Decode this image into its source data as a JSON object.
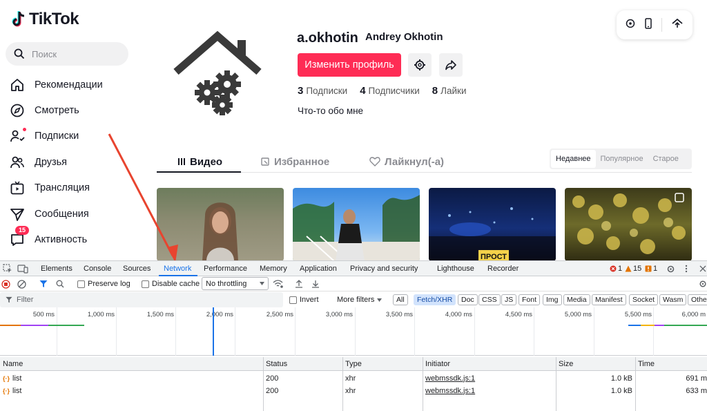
{
  "brand": {
    "name": "TikTok"
  },
  "search": {
    "placeholder": "Поиск"
  },
  "nav": [
    {
      "label": "Рекомендации",
      "icon": "home-icon"
    },
    {
      "label": "Смотреть",
      "icon": "compass-icon"
    },
    {
      "label": "Подписки",
      "icon": "following-icon"
    },
    {
      "label": "Друзья",
      "icon": "friends-icon"
    },
    {
      "label": "Трансляция",
      "icon": "live-icon"
    },
    {
      "label": "Сообщения",
      "icon": "messages-icon"
    },
    {
      "label": "Активность",
      "icon": "activity-icon",
      "badge": "15"
    }
  ],
  "profile": {
    "username": "a.okhotin",
    "nickname": "Andrey Okhotin",
    "edit_button": "Изменить профиль",
    "stats": [
      {
        "value": "3",
        "label": "Подписки"
      },
      {
        "value": "4",
        "label": "Подписчики"
      },
      {
        "value": "8",
        "label": "Лайки"
      }
    ],
    "bio": "Что-то обо мне"
  },
  "content_tabs": [
    "Видео",
    "Избранное",
    "Лайкнул(-а)"
  ],
  "sort_options": [
    "Недавнее",
    "Популярное",
    "Старое"
  ],
  "thumbnail_overlay": "ПРОСТ",
  "devtools": {
    "tabs": [
      "Elements",
      "Console",
      "Sources",
      "Network",
      "Performance",
      "Memory",
      "Application",
      "Privacy and security",
      "Lighthouse",
      "Recorder"
    ],
    "active_tab": "Network",
    "status": {
      "errors": "1",
      "warnings": "15",
      "issues": "1"
    },
    "toolbar": {
      "preserve_log": "Preserve log",
      "disable_cache": "Disable cache",
      "throttling": "No throttling"
    },
    "filter": {
      "placeholder": "Filter",
      "invert": "Invert",
      "more_filters": "More filters",
      "types": [
        "All",
        "Fetch/XHR",
        "Doc",
        "CSS",
        "JS",
        "Font",
        "Img",
        "Media",
        "Manifest",
        "Socket",
        "Wasm",
        "Other"
      ],
      "active_type": "Fetch/XHR"
    },
    "timeline_ticks": [
      "500 ms",
      "1,000 ms",
      "1,500 ms",
      "2,000 ms",
      "2,500 ms",
      "3,000 ms",
      "3,500 ms",
      "4,000 ms",
      "4,500 ms",
      "5,000 ms",
      "5,500 ms",
      "6,000 m"
    ],
    "columns": [
      "Name",
      "Status",
      "Type",
      "Initiator",
      "Size",
      "Time"
    ],
    "rows": [
      {
        "name": "list",
        "status": "200",
        "type": "xhr",
        "initiator": "webmssdk.js:1",
        "size": "1.0 kB",
        "time": "691 m"
      },
      {
        "name": "list",
        "status": "200",
        "type": "xhr",
        "initiator": "webmssdk.js:1",
        "size": "1.0 kB",
        "time": "633 m"
      }
    ]
  },
  "colors": {
    "accent": "#fe2c55",
    "devtools_blue": "#1a73e8",
    "annotation_arrow": "#e8442f"
  }
}
